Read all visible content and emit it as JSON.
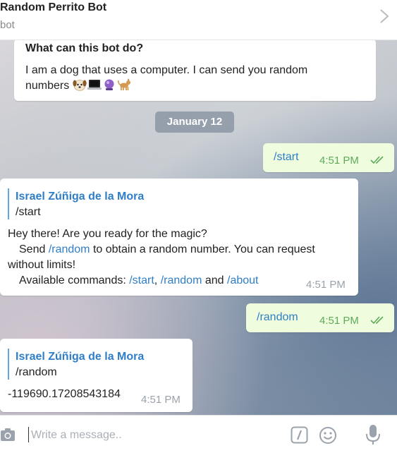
{
  "header": {
    "title": "Random Perrito Bot",
    "subtitle": "bot"
  },
  "intro": {
    "question": "What can this bot do?",
    "answer": "I am a dog that uses a computer. I can send you random numbers",
    "emojis": [
      "dog-face",
      "laptop",
      "crystal-ball",
      "dog"
    ]
  },
  "date_separator": "January 12",
  "messages": [
    {
      "direction": "out",
      "text": "/start",
      "time": "4:51 PM",
      "status": "read"
    },
    {
      "direction": "in",
      "reply_to": {
        "name": "Israel Zúñiga de la Mora",
        "text": "/start"
      },
      "line1": "Hey there! Are you ready for the magic?",
      "line2_pre": "Send ",
      "line2_cmd": "/random",
      "line2_post": " to obtain a random number. You can request",
      "line3": "without limits!",
      "line4_pre": "Available commands: ",
      "cmd_start": "/start",
      "comma": ",",
      "cmd_random": "/random",
      "and": "and",
      "cmd_about": "/about",
      "time": "4:51 PM"
    },
    {
      "direction": "out",
      "text": "/random",
      "time": "4:51 PM",
      "status": "read"
    },
    {
      "direction": "in",
      "reply_to": {
        "name": "Israel Zúñiga de la Mora",
        "text": "/random"
      },
      "text": "-119690.17208543184",
      "time": "4:51 PM"
    }
  ],
  "composer": {
    "placeholder": "Write a message..",
    "icons": [
      "camera-icon",
      "command-icon",
      "emoji-icon",
      "microphone-icon"
    ]
  },
  "colors": {
    "link": "#2f7ec7",
    "outgoing_bubble": "#effdde",
    "outgoing_time": "#5cab5a"
  }
}
